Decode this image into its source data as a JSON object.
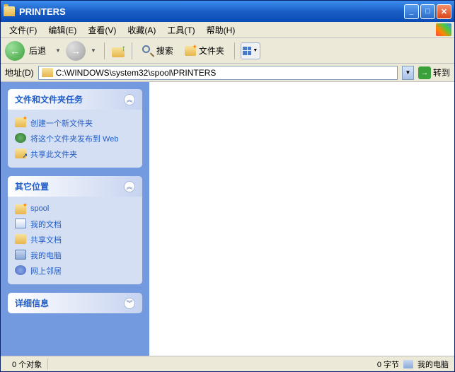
{
  "titlebar": {
    "title": "PRINTERS"
  },
  "menubar": {
    "file": "文件(F)",
    "edit": "编辑(E)",
    "view": "查看(V)",
    "favorites": "收藏(A)",
    "tools": "工具(T)",
    "help": "帮助(H)"
  },
  "toolbar": {
    "back_label": "后退",
    "search_label": "搜索",
    "folders_label": "文件夹"
  },
  "addressbar": {
    "label": "地址(D)",
    "path": "C:\\WINDOWS\\system32\\spool\\PRINTERS",
    "go_label": "转到"
  },
  "sidebar": {
    "panels": [
      {
        "title": "文件和文件夹任务",
        "items": [
          {
            "icon": "newfolder",
            "label": "创建一个新文件夹"
          },
          {
            "icon": "web",
            "label": "将这个文件夹发布到 Web"
          },
          {
            "icon": "share",
            "label": "共享此文件夹"
          }
        ]
      },
      {
        "title": "其它位置",
        "items": [
          {
            "icon": "folder",
            "label": "spool"
          },
          {
            "icon": "docs",
            "label": "我的文档"
          },
          {
            "icon": "shared",
            "label": "共享文档"
          },
          {
            "icon": "computer",
            "label": "我的电脑"
          },
          {
            "icon": "network",
            "label": "网上邻居"
          }
        ]
      },
      {
        "title": "详细信息",
        "collapsed": true
      }
    ]
  },
  "statusbar": {
    "objects": "0 个对象",
    "bytes": "0 字节",
    "location": "我的电脑"
  }
}
